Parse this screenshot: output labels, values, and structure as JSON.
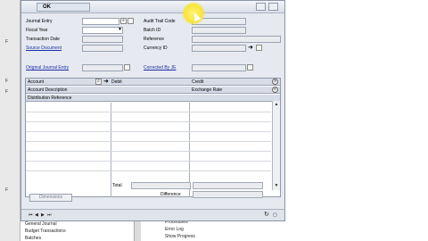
{
  "toolbar": {
    "ok_label": "OK"
  },
  "header": {
    "journal_entry_label": "Journal Entry",
    "audit_trail_label": "Audit Trail Code",
    "fiscal_year_label": "Fiscal Year",
    "batch_id_label": "Batch ID",
    "transaction_date_label": "Transaction Date",
    "reference_label": "Reference",
    "source_document_label": "Source Document",
    "currency_id_label": "Currency ID",
    "original_journal_entry_label": "Original Journal Entry",
    "corrected_by_je_label": "Corrected By JE"
  },
  "grid": {
    "col_account": "Account",
    "col_debit": "Debit",
    "col_credit": "Credit",
    "col_account_description": "Account Description",
    "col_exchange_rate": "Exchange Rate",
    "col_distribution_reference": "Distribution Reference"
  },
  "totals": {
    "total_label": "Total",
    "difference_label": "Difference"
  },
  "buttons": {
    "dimensions_label": "Dimensions"
  },
  "background": {
    "left_items": [
      "General Journal",
      "Budget Transactions",
      "Batches"
    ],
    "right_items": [
      "Procedures",
      "Error Log",
      "Show Progress"
    ]
  },
  "colors": {
    "accent": "#1a2fa8",
    "cursor_highlight": "#f7e43a"
  }
}
